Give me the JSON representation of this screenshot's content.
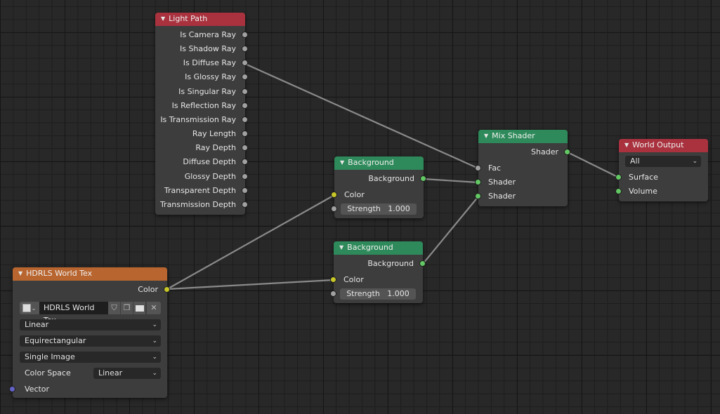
{
  "editor": "Shader Node Editor",
  "nodes": {
    "light_path": {
      "title": "Light Path",
      "header_color": "#a9323e",
      "outputs": [
        "Is Camera Ray",
        "Is Shadow Ray",
        "Is Diffuse Ray",
        "Is Glossy Ray",
        "Is Singular Ray",
        "Is Reflection Ray",
        "Is Transmission Ray",
        "Ray Length",
        "Ray Depth",
        "Diffuse Depth",
        "Glossy Depth",
        "Transparent Depth",
        "Transmission Depth"
      ]
    },
    "background1": {
      "title": "Background",
      "header_color": "#2e8a5a",
      "output": "Background",
      "input_color": "Color",
      "strength_label": "Strength",
      "strength_value": "1.000"
    },
    "background2": {
      "title": "Background",
      "header_color": "#2e8a5a",
      "output": "Background",
      "input_color": "Color",
      "strength_label": "Strength",
      "strength_value": "1.000"
    },
    "mix_shader": {
      "title": "Mix Shader",
      "header_color": "#2e8a5a",
      "output": "Shader",
      "inputs": [
        "Fac",
        "Shader",
        "Shader"
      ]
    },
    "world_output": {
      "title": "World Output",
      "header_color": "#a9323e",
      "target": "All",
      "inputs": [
        "Surface",
        "Volume"
      ]
    },
    "env_tex": {
      "title": "HDRLS World Tex",
      "header_color": "#b8652f",
      "output": "Color",
      "image_name": "HDRLS World Tex",
      "interpolation": "Linear",
      "projection": "Equirectangular",
      "source": "Single Image",
      "color_space_label": "Color Space",
      "color_space": "Linear",
      "input_vector": "Vector"
    }
  },
  "links": [
    {
      "from": "Light Path.Is Diffuse Ray",
      "to": "Mix Shader.Fac"
    },
    {
      "from": "Background (top).Background",
      "to": "Mix Shader.Shader 1"
    },
    {
      "from": "Background (bottom).Background",
      "to": "Mix Shader.Shader 2"
    },
    {
      "from": "Mix Shader.Shader",
      "to": "World Output.Surface"
    },
    {
      "from": "HDRLS World Tex.Color",
      "to": "Background (top).Color"
    },
    {
      "from": "HDRLS World Tex.Color",
      "to": "Background (bottom).Color"
    }
  ]
}
